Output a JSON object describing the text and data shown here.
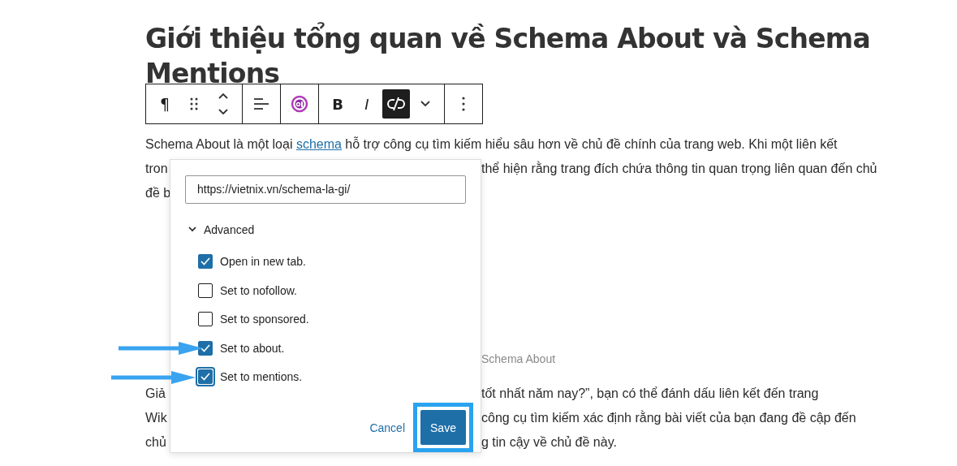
{
  "heading": {
    "lines": [
      "Giới thiệu tổng quan về Schema About và Schema",
      "Mentions"
    ]
  },
  "toolbar": {
    "groups": [
      {
        "items": [
          {
            "kind": "glyph",
            "label": "¶",
            "pressed": false
          },
          {
            "kind": "drag",
            "pressed": false
          },
          {
            "kind": "move",
            "pressed": false
          }
        ]
      },
      {
        "items": [
          {
            "kind": "align",
            "pressed": false
          }
        ]
      },
      {
        "items": [
          {
            "kind": "ai",
            "pressed": false
          }
        ]
      },
      {
        "items": [
          {
            "kind": "bold",
            "label": "B",
            "pressed": false
          },
          {
            "kind": "italic",
            "label": "I",
            "pressed": false
          },
          {
            "kind": "unlink",
            "pressed": true
          },
          {
            "kind": "chevron",
            "pressed": false
          }
        ]
      },
      {
        "items": [
          {
            "kind": "more",
            "pressed": false
          }
        ]
      }
    ]
  },
  "blocks": [
    {
      "kind": "text",
      "lines": [
        {
          "before": "Schema About là một loại",
          "link": "schema",
          "after": "hỗ trợ công cụ tìm kiếm hiểu sâu hơn về chủ đề chính của trang web. Khi một liên kết"
        },
        {
          "left": "tron",
          "right": "thể hiện rằng trang đích chứa thông tin quan trọng liên quan đến chủ"
        },
        {
          "left": "đề b"
        }
      ]
    },
    {
      "kind": "caption",
      "lines": [
        {
          "right": "Schema About"
        }
      ]
    },
    {
      "kind": "text",
      "lines": [
        {
          "left": "Giả",
          "right": "tốt nhất năm nay?”, bạn có thể đánh dấu liên kết đến trang"
        },
        {
          "left": "Wik",
          "right": "công cụ tìm kiếm xác định rằng bài viết của bạn đang đề cập đến"
        },
        {
          "left": "chủ",
          "right": "g tin cậy về chủ đề này."
        }
      ]
    }
  ],
  "link_popover": {
    "url": "https://vietnix.vn/schema-la-gi/",
    "advanced": {
      "label": "Advanced",
      "expanded": true
    },
    "options": [
      {
        "label": "Open in new tab.",
        "checked": true,
        "focused": false,
        "annotated": false
      },
      {
        "label": "Set to nofollow.",
        "checked": false,
        "focused": false,
        "annotated": false
      },
      {
        "label": "Set to sponsored.",
        "checked": false,
        "focused": false,
        "annotated": false
      },
      {
        "label": "Set to about.",
        "checked": true,
        "focused": false,
        "annotated": true
      },
      {
        "label": "Set to mentions.",
        "checked": true,
        "focused": true,
        "annotated": true
      }
    ],
    "cancel": "Cancel",
    "save": {
      "label": "Save",
      "annotated": true
    }
  }
}
